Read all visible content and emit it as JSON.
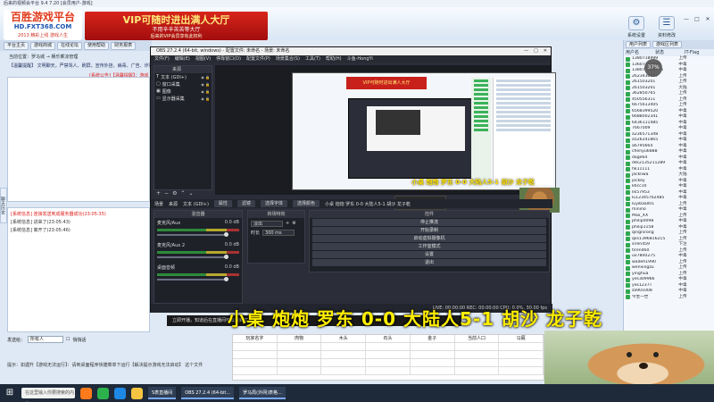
{
  "titlebar": {
    "text": "后来的视频会平台 9.4 7.20 [会员用户-游戏]"
  },
  "logo": {
    "top": "百胜游戏平台",
    "mid": "HD.FXT368.COM",
    "bot": "2013 精彩上线 游戏人生"
  },
  "promo": {
    "line1": "VIP可随时进出满人大厅",
    "line2": "不用辛辛苦苦等大厅",
    "line3": "后来的VIP会员享有此权利"
  },
  "top_icons": [
    {
      "icon": "gear-icon",
      "glyph": "⚙",
      "label": "系统设置"
    },
    {
      "icon": "user-card-icon",
      "glyph": "☰",
      "label": "资料修改"
    }
  ],
  "window_controls": {
    "minimize": "—",
    "maximize": "□",
    "close": "✕"
  },
  "navbar": [
    "平台主页",
    "游戏商城",
    "在线论坛",
    "使用帮助",
    "财务报表"
  ],
  "breadcrumb": "当前位置：罗马城 → 娱乐乘凉管理",
  "info_line": "【温馨提醒】 文明聊天，严禁骂人、刷屏，宣传外挂、病毒、广告、诈骗、赌博、盗号等 有害言论，谢谢合作！",
  "system_msg": "[系统公告]【温馨提醒】：游戏",
  "side_tab": "聊天历史",
  "chat": [
    "[系统信息] 连接发送到成服务器成功(23:05:35)",
    "[系统信息] 进来了(23:05:43)",
    "[系统信息] 离开了(23:05:46)"
  ],
  "send": {
    "label": "发送给：",
    "target": "所有人",
    "checkbox_label": "悄悄话",
    "button": "发送"
  },
  "tip": "提示：如遇升【游戏无法运行】：请到桌面程序快捷菜单下运行【解决提示游戏无法启动】 这个文件",
  "right_panel": {
    "tabs": [
      "用户列表",
      "游戏区列表"
    ],
    "columns": [
      "用户名",
      "状态",
      "IT-Flag"
    ],
    "users": [
      [
        "1380718999",
        "上传"
      ],
      [
        "13607738999",
        "中毒"
      ],
      [
        "138077789776",
        "中毒"
      ],
      [
        "2623430657",
        "上传"
      ],
      [
        "261503201",
        "上传"
      ],
      [
        "261503201",
        "大陆"
      ],
      [
        "362850765",
        "上传"
      ],
      [
        "450556311",
        "上传"
      ],
      [
        "6675613405",
        "上传"
      ],
      [
        "6568399520",
        "中毒"
      ],
      [
        "6688002341",
        "中毒"
      ],
      [
        "6436111485",
        "中毒"
      ],
      [
        "7667009",
        "中毒"
      ],
      [
        "a236571348",
        "中毒"
      ],
      [
        "a526241865",
        "中毒"
      ],
      [
        "a6795664",
        "中毒"
      ],
      [
        "chenyu6888",
        "中毒"
      ],
      [
        "dage64",
        "中毒"
      ],
      [
        "dsk2135211289",
        "中毒"
      ],
      [
        "hk11111",
        "中毒"
      ],
      [
        "jackliwa",
        "大陆"
      ],
      [
        "jockey",
        "中毒"
      ],
      [
        "k6cc10",
        "中毒"
      ],
      [
        "lik57953",
        "中毒"
      ],
      [
        "lu12345762485",
        "中毒"
      ],
      [
        "luyibaall01",
        "上传"
      ],
      [
        "minino",
        "中毒"
      ],
      [
        "Max_XX",
        "上传"
      ],
      [
        "philip0098",
        "中毒"
      ],
      [
        "philip1158",
        "中毒"
      ],
      [
        "qingnirong",
        "上传"
      ],
      [
        "qxs1396816215",
        "上传"
      ],
      [
        "siren459",
        "下注"
      ],
      [
        "tiren460",
        "上传"
      ],
      [
        "ux7800275",
        "中毒"
      ],
      [
        "wadeh1990",
        "上传"
      ],
      [
        "wenxingzu",
        "上传"
      ],
      [
        "yinghua",
        "上传"
      ],
      [
        "yes309966",
        "中毒"
      ],
      [
        "yes1237T",
        "中毒"
      ],
      [
        "za901008",
        "中毒"
      ],
      [
        "今生一世",
        "上传"
      ]
    ]
  },
  "ping": {
    "value": "37",
    "unit": "%"
  },
  "obs": {
    "title": "OBS 27.2.4 (64-bit, windows) - 配置文件: 未命名 - 场景: 未命名",
    "menu": [
      "文件(F)",
      "编辑(E)",
      "视图(V)",
      "停靠窗口(D)",
      "配置文件(P)",
      "场景集合(S)",
      "工具(T)",
      "帮助(H)",
      "斗鱼-HongYi"
    ],
    "sources_header": "来源",
    "sources": [
      {
        "icon": "text-icon",
        "glyph": "T",
        "name": "文本 (GDI+)"
      },
      {
        "icon": "window-icon",
        "glyph": "▢",
        "name": "窗口采集"
      },
      {
        "icon": "image-icon",
        "glyph": "▣",
        "name": "图像"
      },
      {
        "icon": "display-icon",
        "glyph": "▭",
        "name": "显示器采集"
      }
    ],
    "preview_banner": "VIP可随时进出满人大厅",
    "preview_caption": "小桌 炮炮 罗东 0-0 大陆人5-1 胡沙 龙子乾",
    "toast": "斗鱼平台开播成功",
    "midbar": {
      "scene": "场景",
      "source_label": "来源",
      "text_source": "文本 (GDI+)",
      "props": "属性",
      "filters": "滤镜",
      "select_text": "选择字体",
      "select_color": "选择颜色",
      "preview_text": "小桌 炮炮 罗东 0-0 大陆人5-1 胡沙 龙子乾"
    },
    "mixer_header": "混音器",
    "mixer": [
      {
        "name": "麦克风/Aux",
        "db": "0.0 dB",
        "level": 0.72
      },
      {
        "name": "麦克风/Aux 2",
        "db": "0.0 dB",
        "level": 0.72
      },
      {
        "name": "桌面音频",
        "db": "0.0 dB",
        "level": 0.72
      }
    ],
    "transitions_header": "转场特效",
    "transitions": {
      "type": "淡出",
      "duration_label": "时长",
      "duration": "300 ms"
    },
    "controls_header": "控件",
    "controls": [
      "停止推流",
      "开始录制",
      "启动虚拟摄像机",
      "工作室模式",
      "设置",
      "退出"
    ],
    "status": "LIVE: 00:00:00  REC: 00:00:00  CPU: 0.0%, 30.00 fps"
  },
  "stream_status": "立即开播，知道后在直播间可以看到了",
  "caption": "小桌 炮炮 罗东 0-0 大陆人5-1 胡沙 龙子乾",
  "sheet": {
    "headers": [
      "玩家名字",
      "肉物",
      "木头",
      "石头",
      "金子",
      "当前人口",
      "马厩"
    ]
  },
  "taskbar": {
    "search": "在这里输入你要搜索的内容",
    "tasks": [
      "S表直播间",
      "OBS 27.2.4 (64-bit...",
      "罗马局(外网)表格..."
    ],
    "app_icons": [
      {
        "icon": "firefox-icon",
        "color": "#ff7a1a"
      },
      {
        "icon": "chrome-icon",
        "color": "#2bb24c"
      },
      {
        "icon": "edge-icon",
        "color": "#1e88e5"
      },
      {
        "icon": "explorer-icon",
        "color": "#f5c542"
      }
    ]
  }
}
